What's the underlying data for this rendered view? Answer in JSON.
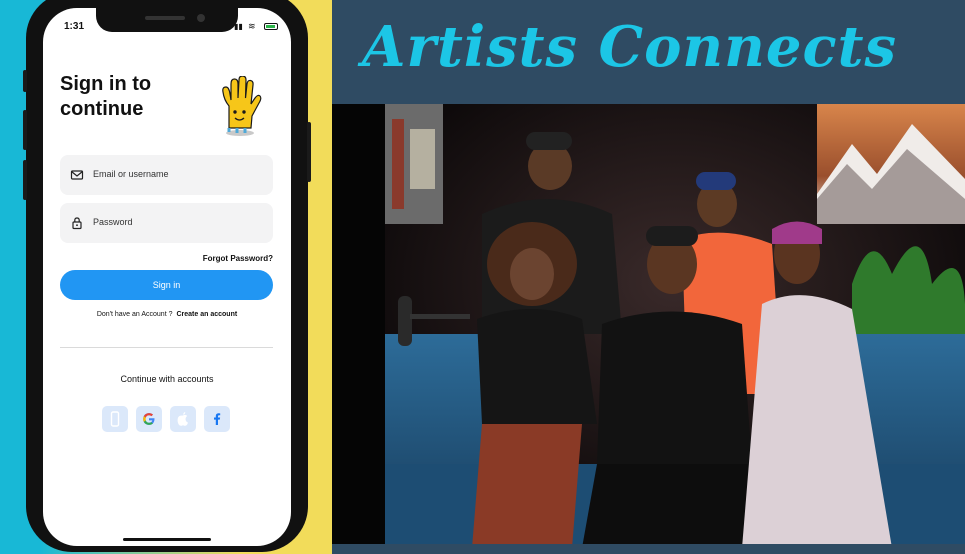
{
  "phone": {
    "status_time": "1:31"
  },
  "signin": {
    "title_line1": "Sign in to",
    "title_line2": "continue",
    "email_placeholder": "Email or username",
    "password_placeholder": "Password",
    "forgot_password": "Forgot Password?",
    "signin_button": "Sign in",
    "no_account_text": "Don't have an Account ?",
    "create_account": "Create an account",
    "continue_with": "Continue with accounts"
  },
  "social_buttons": [
    {
      "name": "phone-icon"
    },
    {
      "name": "google-icon"
    },
    {
      "name": "apple-icon"
    },
    {
      "name": "facebook-icon"
    }
  ],
  "banner": {
    "title": "Artists Connects"
  },
  "colors": {
    "primary_button": "#2196f3",
    "banner_bg": "#2f4b63",
    "banner_text": "#1cc6e6",
    "left_bg_cyan": "#18b8d6",
    "left_bg_yellow": "#f2dc5a"
  }
}
